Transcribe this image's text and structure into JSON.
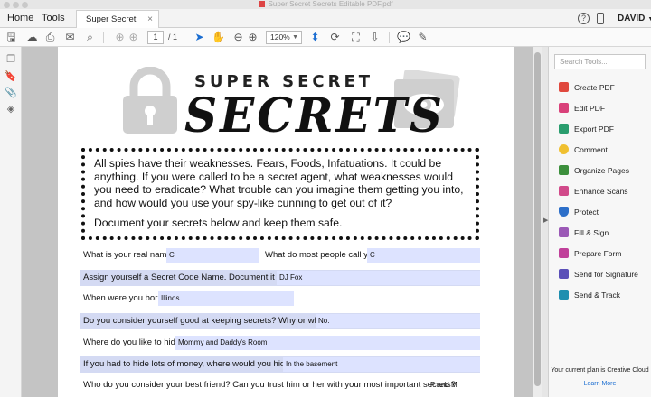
{
  "window": {
    "title": "Super Secret Secrets Editable PDF.pdf"
  },
  "menu": {
    "home": "Home",
    "tools": "Tools"
  },
  "doc_tab": {
    "label": "Super Secret Secr...",
    "close": "×"
  },
  "header_right": {
    "help": "?",
    "user": "DAVID"
  },
  "toolbar": {
    "page_current": "1",
    "page_total": "/ 1",
    "zoom": "120%"
  },
  "document": {
    "title_small": "SUPER SECRET",
    "title_big": "SECRETS",
    "intro_p1": "All spies have their weaknesses.  Fears, Foods, Infatuations.  It could be anything.  If you were called to be a secret agent, what weaknesses would you need to eradicate? What trouble can you imagine them getting you into, and how would you use your spy-like cunning to get out of it?",
    "intro_p2": "Document your secrets below and keep them safe.",
    "q_real_name": "What is your real name?",
    "a_real_name": "C",
    "q_people_call": "What do most people call you?",
    "a_people_call": "C",
    "q_code_name": "Assign yourself a Secret Code Name.  Document it here:",
    "a_code_name": "DJ Fox",
    "q_born": "When were you born?",
    "a_born": "Illinos",
    "q_good_secrets": "Do you consider yourself good at keeping secrets?  Why or why not?",
    "a_good_secrets": "No.",
    "q_hide": "Where do you like to hide?",
    "a_hide": "Mommy and Daddy's Room",
    "q_money": "If you had to hide lots of money, where would you hide it?",
    "a_money": "In the basement",
    "q_best_friend": "Who do you consider your best friend?  Can you trust him or her with your most important secrets?",
    "a_best_friend": "P and M"
  },
  "tools_pane": {
    "search_placeholder": "Search Tools...",
    "items": [
      {
        "label": "Create PDF",
        "color": "#e0483e"
      },
      {
        "label": "Edit PDF",
        "color": "#d9417a"
      },
      {
        "label": "Export PDF",
        "color": "#2a9d6e"
      },
      {
        "label": "Comment",
        "color": "#f0c030"
      },
      {
        "label": "Organize Pages",
        "color": "#3c8f3c"
      },
      {
        "label": "Enhance Scans",
        "color": "#d14a8a"
      },
      {
        "label": "Protect",
        "color": "#2d6fc9"
      },
      {
        "label": "Fill & Sign",
        "color": "#9b59b6"
      },
      {
        "label": "Prepare Form",
        "color": "#c0409a"
      },
      {
        "label": "Send for Signature",
        "color": "#5a4fb8"
      },
      {
        "label": "Send & Track",
        "color": "#1f8fb0"
      }
    ],
    "plan_text": "Your current plan is Creative Cloud",
    "learn_more": "Learn More"
  }
}
